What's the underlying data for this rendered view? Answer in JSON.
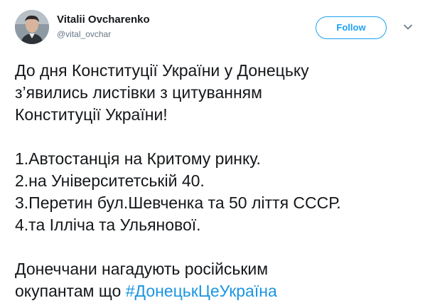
{
  "author": {
    "display_name": "Vitalii Ovcharenko",
    "handle": "@vital_ovchar"
  },
  "follow_button": {
    "label": "Follow"
  },
  "icons": {
    "more": "chevron-down-icon",
    "avatar": "avatar"
  },
  "colors": {
    "accent": "#1da1f2",
    "hashtag": "#1b95e0",
    "text": "#14171a",
    "muted": "#657786"
  },
  "tweet": {
    "lines": [
      "До дня Конституції України у Донецьку",
      "з’явились листівки з цитуванням",
      "Конституції України!",
      "1.Автостанція на Критому ринку.",
      "2.на Університетській 40.",
      "3.Перетин бул.Шевченка та 50 ліття СССР.",
      "4.та Ілліча та Ульянової.",
      "Донеччани нагадують російським"
    ],
    "last_line_prefix": "окупантам що ",
    "hashtag": "#ДонецькЦеУкраїна"
  }
}
